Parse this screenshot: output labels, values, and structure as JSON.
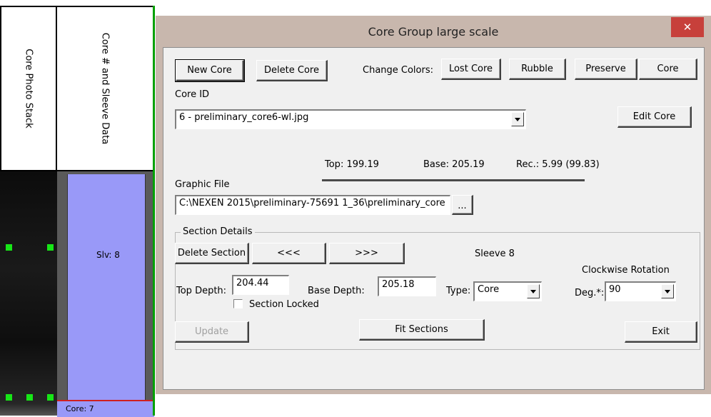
{
  "left_panel": {
    "col1_header": "Core Photo Stack",
    "col2_header": "Core # and Sleeve Data",
    "sleeve_label": "Slv: 8",
    "core_label": "Core: 7",
    "sleeve_color": "#9999f8"
  },
  "dialog": {
    "title": "Core Group large scale",
    "close_glyph": "✕",
    "buttons": {
      "new_core": "New Core",
      "delete_core": "Delete Core",
      "lost_core": "Lost Core",
      "rubble": "Rubble",
      "preserve": "Preserve",
      "core": "Core",
      "edit_core": "Edit Core",
      "browse": "...",
      "delete_section": "Delete Section",
      "prev": "<<<",
      "next": ">>>",
      "update": "Update",
      "fit_sections": "Fit Sections",
      "exit": "Exit"
    },
    "labels": {
      "change_colors": "Change Colors:",
      "core_id": "Core ID",
      "top": "Top: 199.19",
      "base": "Base: 205.19",
      "rec": "Rec.: 5.99 (99.83)",
      "graphic_file": "Graphic File",
      "section_details": "Section Details",
      "sleeve": "Sleeve 8",
      "clockwise_rotation": "Clockwise Rotation",
      "top_depth": "Top Depth:",
      "base_depth": "Base Depth:",
      "type": "Type:",
      "deg": "Deg.*:",
      "section_locked": "Section Locked"
    },
    "values": {
      "core_id": "6 - preliminary_core6-wl.jpg",
      "graphic_file": "C:\\NEXEN 2015\\preliminary-75691 1_36\\preliminary_core",
      "top_depth": "204.44",
      "base_depth": "205.18",
      "type": "Core",
      "deg": "90",
      "section_locked": false
    }
  }
}
